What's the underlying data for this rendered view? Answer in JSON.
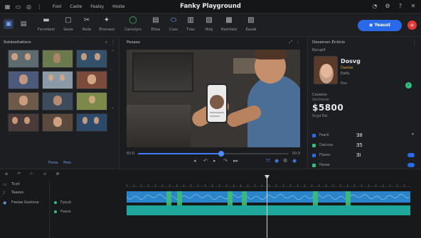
{
  "titlebar": {
    "app_title": "Fanky Playground",
    "menus": [
      "Fool",
      "Caste",
      "Fealsy",
      "Hoste"
    ],
    "left_icons": [
      "grid-icon",
      "window-icon",
      "bell-icon",
      "more-icon"
    ],
    "right_icons": [
      "user-icon",
      "settings-icon",
      "help-icon",
      "close-icon"
    ]
  },
  "toolbar": {
    "tools": [
      {
        "label": "Fsnmbest",
        "icon": "film-icon"
      },
      {
        "label": "Seeie",
        "icon": "save-icon"
      },
      {
        "label": "Reile",
        "icon": "cut-icon"
      },
      {
        "label": "Etionasd",
        "icon": "effects-icon"
      },
      {
        "label": "Carsulyrs",
        "icon": "add-icon"
      },
      {
        "label": "Ettas",
        "icon": "text-icon"
      },
      {
        "label": "Cuss",
        "icon": "crop-icon"
      },
      {
        "label": "Tvas",
        "icon": "audio-icon"
      },
      {
        "label": "Hidy",
        "icon": "filter-icon"
      },
      {
        "label": "Halmtest",
        "icon": "palette-icon"
      },
      {
        "label": "Eaxsb",
        "icon": "export-icon"
      }
    ],
    "export_label": "Yeaust",
    "record_icon": "plus-icon"
  },
  "library": {
    "title": "Sotdestlatters",
    "footer": [
      "Fooa",
      "Peis"
    ]
  },
  "preview": {
    "title": "Pesaaz",
    "time_start": "60:0",
    "time_end": "00:0",
    "progress": 0.55
  },
  "properties": {
    "title": "Deseinon Entinis",
    "subtitle": "Eecuplt",
    "profile_name": "Dosvg",
    "profile_tag": "Dastoe",
    "profile_sub": "Eaifu",
    "small_row": "Peo",
    "section1": "Ceaieiss",
    "section2": "Sentioner",
    "big_value": "$5800",
    "note": "Scgd Eal",
    "items": [
      {
        "key": "Fearll",
        "value": "Ǝ8",
        "color": "#2a6ae8"
      },
      {
        "key": "Dalcoss",
        "value": "Ǝ5",
        "color": "#2ec27e"
      },
      {
        "key": "Flaoss",
        "value": "ƎI",
        "color": "#2a6ae8"
      },
      {
        "key": "Pasae",
        "value": "",
        "color": "#2ec27e"
      }
    ]
  },
  "timeline": {
    "tracks": [
      "Tuyd",
      "Taaees",
      "Fwoaa Gestone"
    ],
    "clip_names": [
      "Fpeyb",
      "Poase"
    ]
  },
  "colors": {
    "accent": "#2a6ae8",
    "record": "#e23b36",
    "audio_clip": "#2a84c9",
    "green_clip": "#1ea79a"
  }
}
